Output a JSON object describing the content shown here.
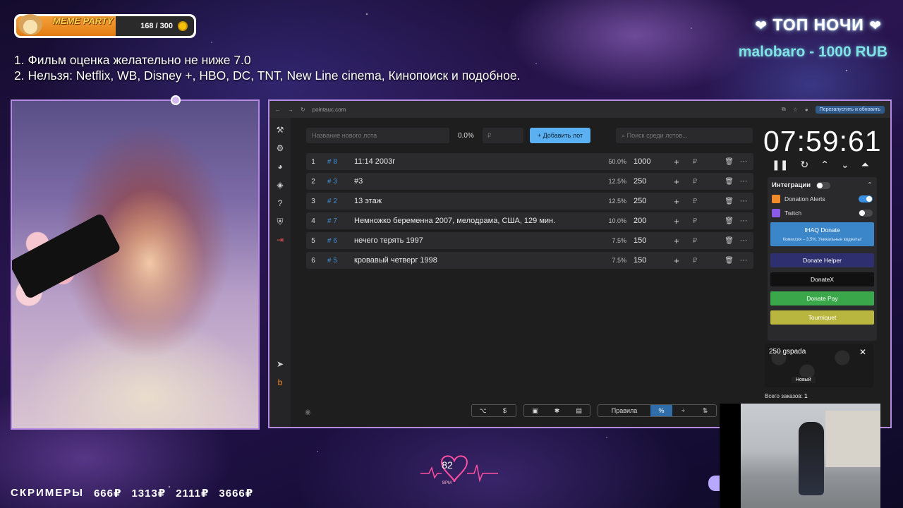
{
  "overlay": {
    "meme_party": {
      "title": "MEME PARTY",
      "current": 168,
      "goal": 300,
      "count_text": "168 / 300",
      "fill_fraction": 0.56,
      "accent": "#e27c12"
    },
    "rules": [
      "1. Фильм оценка желательно не ниже 7.0",
      "2. Нельзя: Netflix, WB, Disney +, HBO, DC, TNT, New Line cinema, Кинопоиск и подобное."
    ],
    "top_night": {
      "title": "ТОП НОЧИ",
      "heart": "❤",
      "donor": "malobaro - 1000 RUB"
    },
    "screamers": {
      "label": "СКРИМЕРЫ",
      "prices": [
        "666₽",
        "1313₽",
        "2111₽",
        "3666₽"
      ]
    },
    "heart_rate": {
      "bpm": "82",
      "label": "BPM"
    }
  },
  "browser": {
    "url": "pointauc.com",
    "action": "Перезапустить и обновить"
  },
  "app": {
    "sidebar_icons": [
      "hammer-icon",
      "gear-icon",
      "wheel-icon",
      "layers-icon",
      "help-icon",
      "shield-icon",
      "logout-icon",
      "telegram-icon",
      "boosty-icon"
    ],
    "toolbar": {
      "lot_placeholder": "Название нового лота",
      "percent": "0.0%",
      "rub_placeholder": "₽",
      "add_button": "Добавить лот",
      "search_placeholder": "Поиск среди лотов..."
    },
    "lots": [
      {
        "index": "1",
        "id": "# 8",
        "name": "11:14 2003г",
        "percent": "50.0%",
        "amount": "1000"
      },
      {
        "index": "2",
        "id": "# 3",
        "name": "#3",
        "percent": "12.5%",
        "amount": "250"
      },
      {
        "index": "3",
        "id": "# 2",
        "name": "13 этаж",
        "percent": "12.5%",
        "amount": "250"
      },
      {
        "index": "4",
        "id": "# 7",
        "name": "Немножко беременна 2007, мелодрама, США, 129 мин.",
        "percent": "10.0%",
        "amount": "200"
      },
      {
        "index": "5",
        "id": "# 6",
        "name": "нечего терять 1997",
        "percent": "7.5%",
        "amount": "150"
      },
      {
        "index": "6",
        "id": "# 5",
        "name": "кровавый четверг 1998",
        "percent": "7.5%",
        "amount": "150"
      }
    ],
    "row_plus": "+",
    "row_rub": "₽",
    "row_delete": "🗑",
    "row_more": "···",
    "timer": "07:59:61",
    "integrations": {
      "title": "Интеграции",
      "services": [
        {
          "name": "Donation Alerts",
          "enabled": true,
          "color": "#f08a2a"
        },
        {
          "name": "Twitch",
          "enabled": false,
          "color": "#8c5ae8"
        }
      ],
      "iha": {
        "label": "IHAQ Donate",
        "note": "Комиссия – 3,5%. Уникальные виджеты!"
      },
      "buttons": [
        {
          "label": "Donate Helper",
          "color": "#2d2f6e"
        },
        {
          "label": "DonateX",
          "color": "#111111"
        },
        {
          "label": "Donate Pay",
          "color": "#3aa84a"
        },
        {
          "label": "Tourniquet",
          "color": "#b9b640"
        }
      ]
    },
    "current_lot": {
      "name": "250 gspada",
      "status": "Новый"
    },
    "orders": {
      "label": "Всего заказов:",
      "value": "1"
    },
    "bottom_tools": {
      "rules_label": "Правила"
    }
  }
}
